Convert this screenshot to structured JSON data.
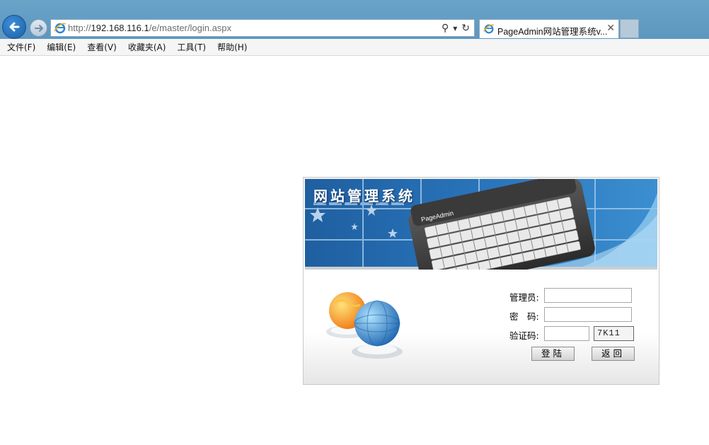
{
  "browser": {
    "url_prefix": "http://",
    "url_host": "192.168.116.1",
    "url_path": "/e/master/login.aspx",
    "tab_title": "PageAdmin网站管理系统v...",
    "tab_close": "✕",
    "search_glyph": "⚲",
    "dropdown_glyph": "▾",
    "refresh_glyph": "↻"
  },
  "menu": {
    "items": [
      "文件(F)",
      "编辑(E)",
      "查看(V)",
      "收藏夹(A)",
      "工具(T)",
      "帮助(H)"
    ]
  },
  "login": {
    "system_title": "网站管理系统",
    "keyboard_brand": "PageAdmin",
    "labels": {
      "admin": "管理员:",
      "password": "密　码:",
      "captcha": "验证码:"
    },
    "captcha_text": "7K11",
    "admin_value": "",
    "password_value": "",
    "captcha_value": "",
    "login_button": "登陆",
    "back_button": "返回"
  },
  "colors": {
    "chrome_blue": "#5d97bf",
    "banner_blue": "#1f63a8",
    "banner_light": "#5aa9dd"
  }
}
